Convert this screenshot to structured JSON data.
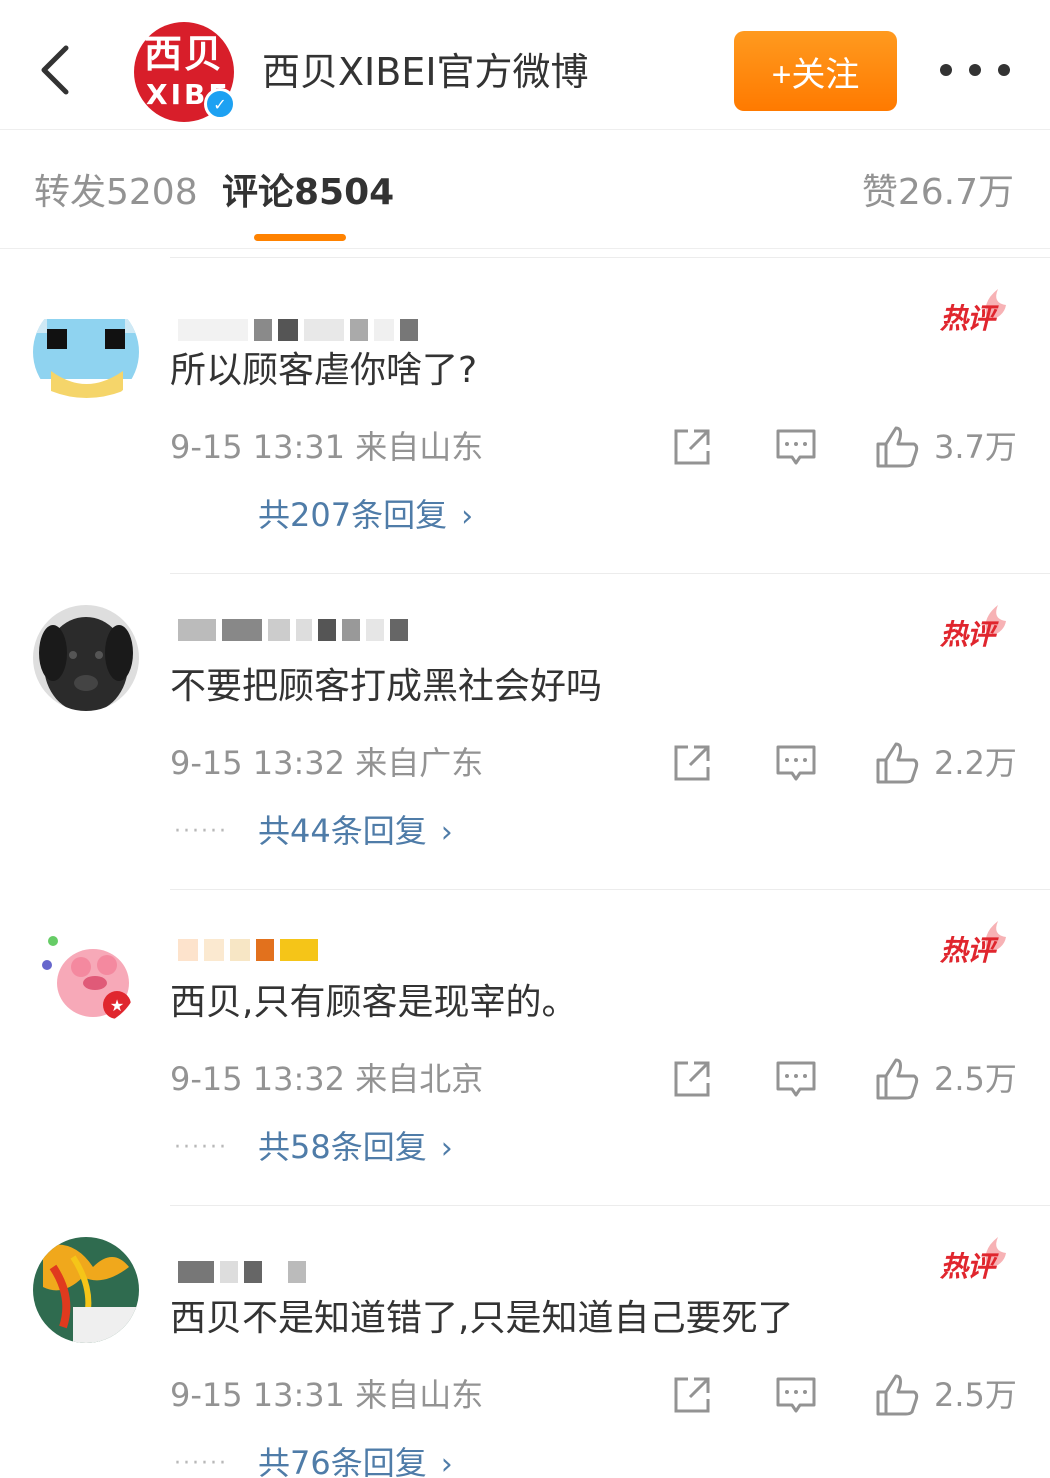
{
  "header": {
    "account_name": "西贝XIBEI官方微博",
    "brand_logo_top": "西贝",
    "brand_logo_bottom": "XIBEI",
    "follow_label": "+关注",
    "accent_color": "#ff8200"
  },
  "tabs": {
    "repost": "转发5208",
    "comment": "评论8504",
    "like": "赞26.7万"
  },
  "comments": [
    {
      "text": "所以顾客虐你啥了?",
      "meta": "9-15 13:31  来自山东",
      "likes": "3.7万",
      "replies": "共207条回复",
      "badge": "热评"
    },
    {
      "text": "不要把顾客打成黑社会好吗",
      "meta": "9-15 13:32  来自广东",
      "likes": "2.2万",
      "replies": "共44条回复",
      "badge": "热评"
    },
    {
      "text": "西贝,只有顾客是现宰的。",
      "meta": "9-15 13:32  来自北京",
      "likes": "2.5万",
      "replies": "共58条回复",
      "badge": "热评"
    },
    {
      "text": "西贝不是知道错了,只是知道自己要死了",
      "meta": "9-15 13:31  来自山东",
      "likes": "2.5万",
      "replies": "共76条回复",
      "badge": "热评"
    }
  ],
  "icons": {
    "back": "chevron-left-icon",
    "more": "more-dots-icon",
    "share": "share-icon",
    "reply": "comment-icon",
    "like": "thumbs-up-icon",
    "hot": "flame-icon"
  }
}
